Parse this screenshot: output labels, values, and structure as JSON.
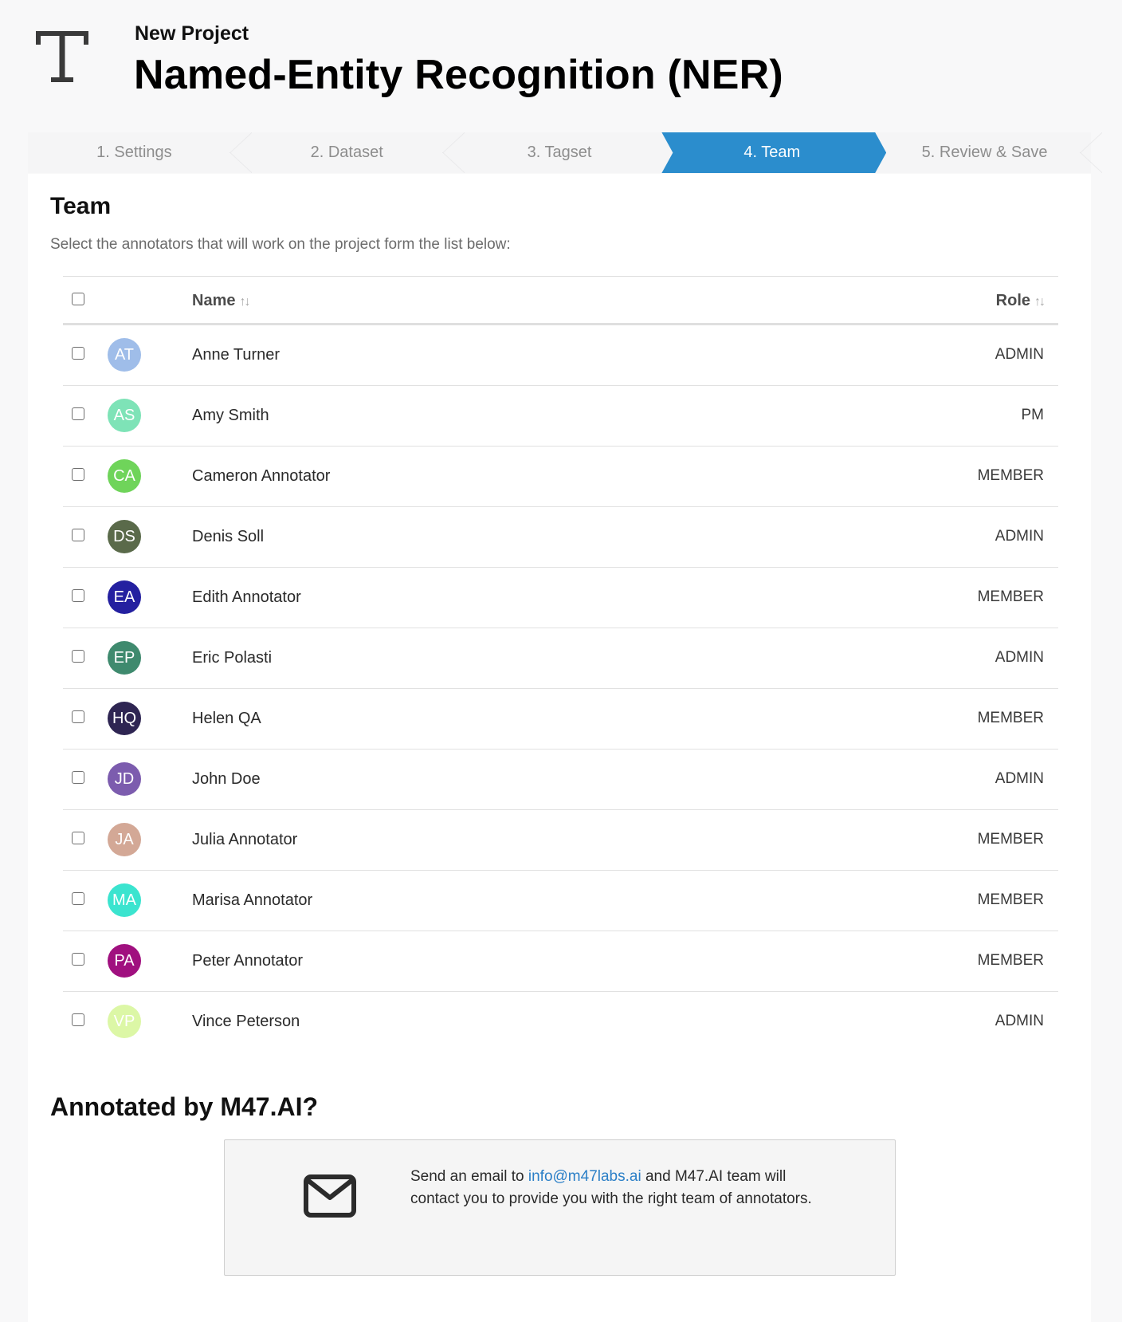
{
  "header": {
    "subtitle": "New Project",
    "title": "Named-Entity Recognition (NER)",
    "icon": "text-type-icon"
  },
  "steps": [
    {
      "label": "1. Settings",
      "active": false
    },
    {
      "label": "2. Dataset",
      "active": false
    },
    {
      "label": "3. Tagset",
      "active": false
    },
    {
      "label": "4. Team",
      "active": true
    },
    {
      "label": "5. Review & Save",
      "active": false
    }
  ],
  "colors": {
    "accent": "#2b8dcd",
    "link": "#2b7fc7"
  },
  "team": {
    "title": "Team",
    "description": "Select the annotators that will work on the project form the list below:",
    "columns": {
      "name": "Name",
      "role": "Role",
      "sort_glyph": "↑↓"
    },
    "members": [
      {
        "initials": "AT",
        "name": "Anne Turner",
        "role": "ADMIN",
        "color": "#9fbde9"
      },
      {
        "initials": "AS",
        "name": "Amy Smith",
        "role": "PM",
        "color": "#7ee3b7"
      },
      {
        "initials": "CA",
        "name": "Cameron Annotator",
        "role": "MEMBER",
        "color": "#6fd45a"
      },
      {
        "initials": "DS",
        "name": "Denis Soll",
        "role": "ADMIN",
        "color": "#5a6a4a"
      },
      {
        "initials": "EA",
        "name": "Edith Annotator",
        "role": "MEMBER",
        "color": "#2420a0"
      },
      {
        "initials": "EP",
        "name": "Eric Polasti",
        "role": "ADMIN",
        "color": "#3f8a6e"
      },
      {
        "initials": "HQ",
        "name": "Helen QA",
        "role": "MEMBER",
        "color": "#2e2552"
      },
      {
        "initials": "JD",
        "name": "John Doe",
        "role": "ADMIN",
        "color": "#7c5cae"
      },
      {
        "initials": "JA",
        "name": "Julia Annotator",
        "role": "MEMBER",
        "color": "#d3a896"
      },
      {
        "initials": "MA",
        "name": "Marisa Annotator",
        "role": "MEMBER",
        "color": "#3be4cf"
      },
      {
        "initials": "PA",
        "name": "Peter Annotator",
        "role": "MEMBER",
        "color": "#a0107f"
      },
      {
        "initials": "VP",
        "name": "Vince Peterson",
        "role": "ADMIN",
        "color": "#dcf7a6"
      }
    ]
  },
  "annotated": {
    "title": "Annotated by M47.AI?",
    "icon": "mail-icon",
    "text_before": "Send an email to ",
    "email": "info@m47labs.ai",
    "text_after": " and M47.AI team will contact you to provide you with the right team of annotators."
  }
}
